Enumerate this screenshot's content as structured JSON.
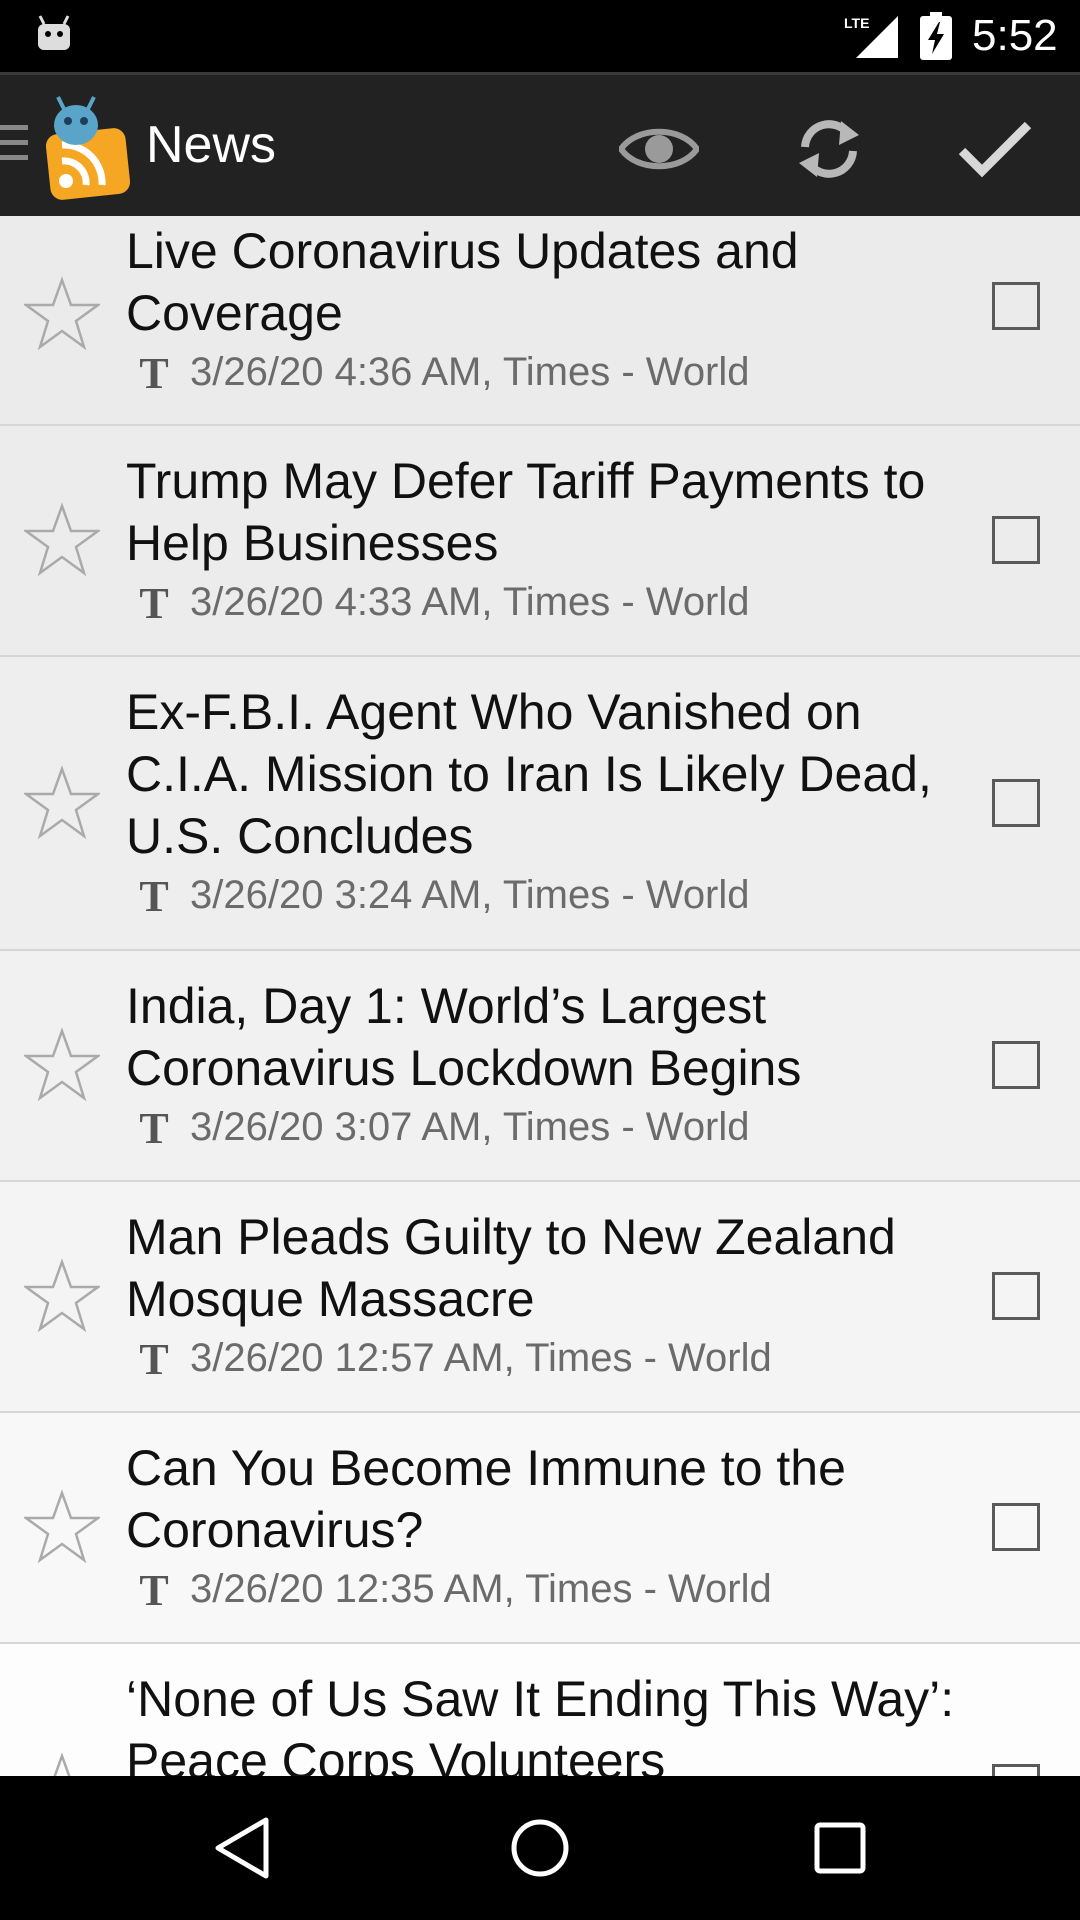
{
  "status_bar": {
    "network": "LTE",
    "time": "5:52"
  },
  "action_bar": {
    "title": "News",
    "icons": [
      "drawer-icon",
      "app-logo-icon",
      "eye-icon",
      "refresh-icon",
      "checkmark-icon"
    ]
  },
  "articles": [
    {
      "title": "Live Coronavirus Updates and Coverage",
      "meta": "3/26/20 4:36 AM, Times - World",
      "starred": false,
      "checked": false
    },
    {
      "title": "Trump May Defer Tariff Payments to Help Businesses",
      "meta": "3/26/20 4:33 AM, Times - World",
      "starred": false,
      "checked": false
    },
    {
      "title": "Ex-F.B.I. Agent Who Vanished on C.I.A. Mission to Iran Is Likely Dead, U.S. Concludes",
      "meta": "3/26/20 3:24 AM, Times - World",
      "starred": false,
      "checked": false
    },
    {
      "title": "India, Day 1: World’s Largest Coronavirus Lockdown Begins",
      "meta": "3/26/20 3:07 AM, Times - World",
      "starred": false,
      "checked": false
    },
    {
      "title": "Man Pleads Guilty to New Zealand Mosque Massacre",
      "meta": "3/26/20 12:57 AM, Times - World",
      "starred": false,
      "checked": false
    },
    {
      "title": "Can You Become Immune to the Coronavirus?",
      "meta": "3/26/20 12:35 AM, Times - World",
      "starred": false,
      "checked": false
    },
    {
      "title": "‘None of Us Saw It Ending This Way’: Peace Corps Volunteers",
      "meta": "",
      "starred": false,
      "checked": false
    }
  ],
  "colors": {
    "action_bar": "#222222",
    "status_bar": "#000000",
    "list_background": "#f0f0f0",
    "headline": "#111111",
    "meta": "#6b6b6b",
    "rss_orange": "#f5a623"
  }
}
